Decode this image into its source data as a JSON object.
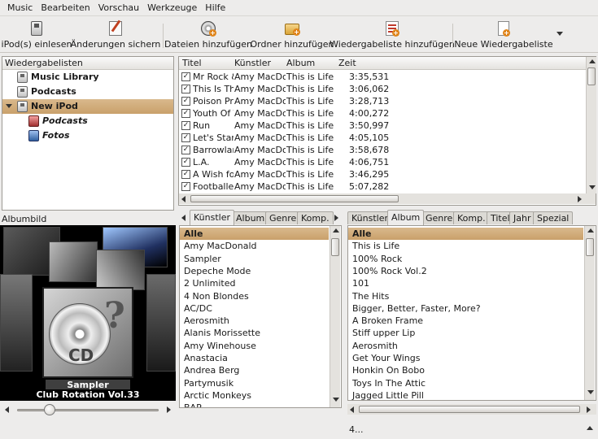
{
  "menu": [
    "Music",
    "Bearbeiten",
    "Vorschau",
    "Werkzeuge",
    "Hilfe"
  ],
  "toolbar": {
    "ipod_read": "iPod(s) einlesen",
    "save_changes": "Änderungen sichern",
    "add_files": "Dateien hinzufügen",
    "add_folder": "Ordner hinzufügen",
    "add_playlist": "Wiedergabeliste hinzufügen",
    "new_playlist": "Neue Wiedergabeliste"
  },
  "playlists": {
    "header": "Wiedergabelisten",
    "items": [
      "Music Library",
      "Podcasts",
      "New iPod",
      "Podcasts",
      "Fotos"
    ]
  },
  "tracks": {
    "columns": [
      "Titel",
      "Künstler",
      "Album",
      "Zeit"
    ],
    "rows": [
      {
        "title": "Mr Rock & Roll",
        "artist": "Amy MacDonald",
        "album": "This is Life",
        "time": "3:35,531"
      },
      {
        "title": "This Is The Life",
        "artist": "Amy MacDonald",
        "album": "This is Life",
        "time": "3:06,062"
      },
      {
        "title": "Poison Prince",
        "artist": "Amy MacDonald",
        "album": "This is Life",
        "time": "3:28,713"
      },
      {
        "title": "Youth Of Today",
        "artist": "Amy MacDonald",
        "album": "This is Life",
        "time": "4:00,272"
      },
      {
        "title": "Run",
        "artist": "Amy MacDonald",
        "album": "This is Life",
        "time": "3:50,997"
      },
      {
        "title": "Let's Start A Band",
        "artist": "Amy MacDonald",
        "album": "This is Life",
        "time": "4:05,105"
      },
      {
        "title": "Barrowland Ballroom",
        "artist": "Amy MacDonald",
        "album": "This is Life",
        "time": "3:58,678"
      },
      {
        "title": "L.A.",
        "artist": "Amy MacDonald",
        "album": "This is Life",
        "time": "4:06,751"
      },
      {
        "title": "A Wish for Something More",
        "artist": "Amy MacDonald",
        "album": "This is Life",
        "time": "3:46,295"
      },
      {
        "title": "Footballer's Wife",
        "artist": "Amy MacDonald",
        "album": "This is Life",
        "time": "5:07,282"
      }
    ]
  },
  "cover": {
    "header": "Albumbild",
    "artist": "Sampler",
    "album": "Club Rotation Vol.33",
    "cd_text": "CD"
  },
  "filter1": {
    "tabs": [
      "Künstler",
      "Album",
      "Genre",
      "Komp."
    ],
    "items": [
      "Alle",
      "Amy MacDonald",
      "Sampler",
      "Depeche Mode",
      "2 Unlimited",
      "4 Non Blondes",
      "AC/DC",
      "Aerosmith",
      "Alanis Morissette",
      "Amy Winehouse",
      "Anastacia",
      "Andrea Berg",
      "Partymusik",
      "Arctic Monkeys",
      "BAP"
    ]
  },
  "filter2": {
    "tabs": [
      "Künstler",
      "Album",
      "Genre",
      "Komp.",
      "Titel",
      "Jahr",
      "Spezial"
    ],
    "items": [
      "Alle",
      "This is Life",
      "100% Rock",
      "100% Rock Vol.2",
      "101",
      "The Hits",
      "Bigger, Better, Faster, More?",
      "A Broken Frame",
      "Stiff upper Lip",
      "Aerosmith",
      "Get Your Wings",
      "Honkin On Bobo",
      "Toys In The Attic",
      "Jagged Little Pill"
    ]
  },
  "status": "4..."
}
